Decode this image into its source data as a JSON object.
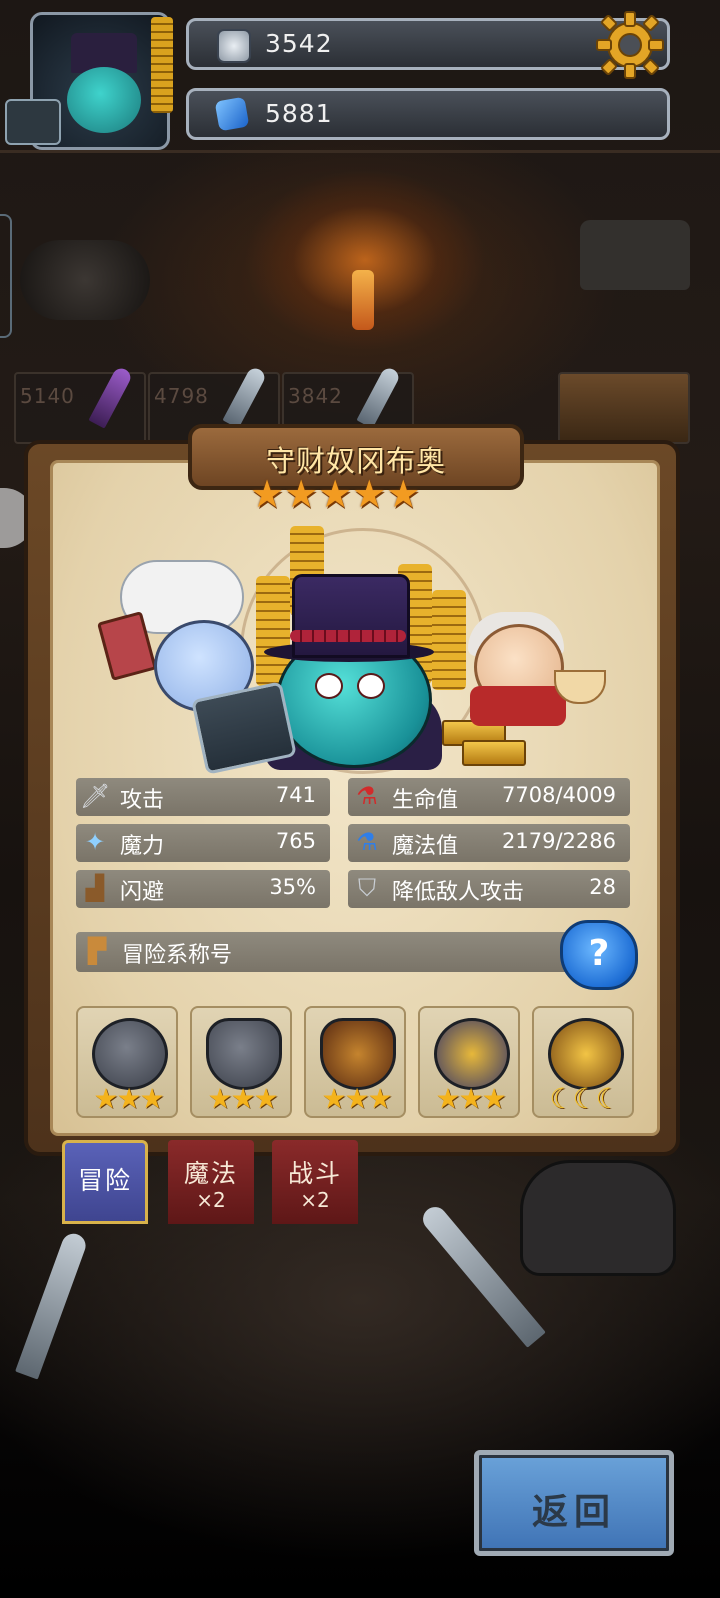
{
  "resources": {
    "silver_coin": "3542",
    "blue_gem": "5881"
  },
  "shelf": [
    "5140",
    "4798",
    "3842"
  ],
  "hero": {
    "name": "守财奴冈布奥",
    "stars": "★★★★★"
  },
  "stats": {
    "attack": {
      "label": "攻击",
      "value": "741"
    },
    "hp": {
      "label": "生命值",
      "value": "7708/4009"
    },
    "magic": {
      "label": "魔力",
      "value": "765"
    },
    "mp": {
      "label": "魔法值",
      "value": "2179/2286"
    },
    "dodge": {
      "label": "闪避",
      "value": "35%"
    },
    "enemy_attack_down": {
      "label": "降低敌人攻击",
      "value": "28"
    }
  },
  "title_section": {
    "label": "冒险系称号",
    "help": "?"
  },
  "badges": [
    {
      "stars": "★★★"
    },
    {
      "stars": "★★★"
    },
    {
      "stars": "★★★"
    },
    {
      "stars": "★★★"
    },
    {
      "stars": "☾☾☾"
    }
  ],
  "tabs": {
    "adventure": {
      "label": "冒险"
    },
    "magic": {
      "label": "魔法",
      "sub": "×2"
    },
    "combat": {
      "label": "战斗",
      "sub": "×2"
    }
  },
  "back_button": "返回",
  "colors": {
    "accent_gold": "#f29b21",
    "panel_wood": "#6b4826",
    "parchment": "#f3e7cb",
    "stat_bar": "#8f8a7e",
    "back_blue": "#3f73b5"
  }
}
